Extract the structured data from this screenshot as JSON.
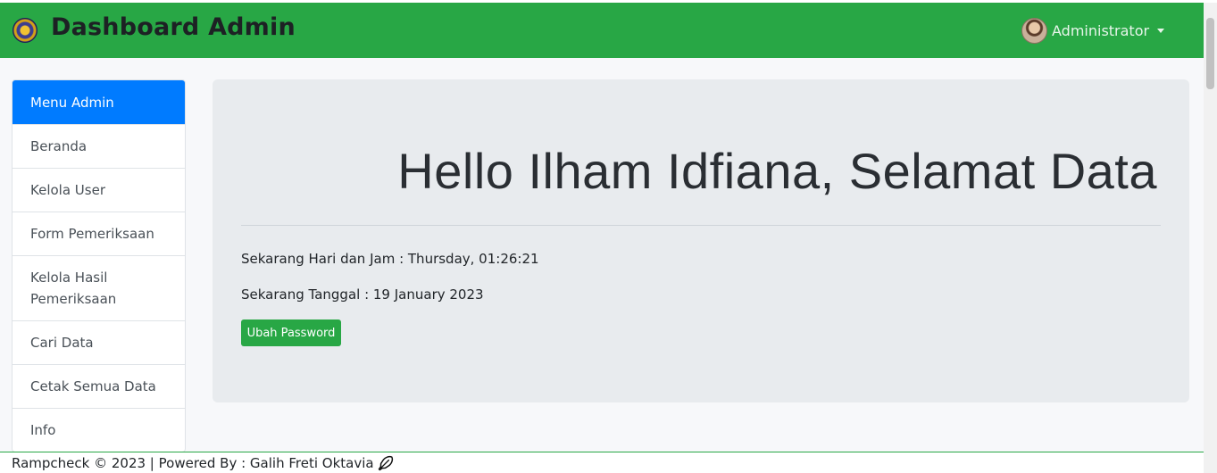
{
  "navbar": {
    "title": "Dashboard Admin",
    "user_name": "Administrator",
    "logo_icon": "emblem-logo",
    "avatar_icon": "user-avatar"
  },
  "sidebar": {
    "items": [
      {
        "label": "Menu Admin",
        "active": true
      },
      {
        "label": "Beranda"
      },
      {
        "label": "Kelola User"
      },
      {
        "label": "Form Pemeriksaan"
      },
      {
        "label": "Kelola Hasil Pemeriksaan"
      },
      {
        "label": "Cari Data"
      },
      {
        "label": "Cetak Semua Data"
      },
      {
        "label": "Info"
      }
    ]
  },
  "main": {
    "greeting": "Hello Ilham Idfiana, Selamat Data",
    "time_text": "Sekarang Hari dan Jam : Thursday, 01:26:21",
    "date_text": "Sekarang Tanggal : 19 January 2023",
    "change_password_label": "Ubah Password"
  },
  "footer": {
    "text": "Rampcheck © 2023 | Powered By : Galih Freti Oktavia",
    "icon": "feather-icon"
  },
  "colors": {
    "navbar_bg": "#28a745",
    "active_menu": "#007bff",
    "jumbotron_bg": "#e8ebee"
  }
}
